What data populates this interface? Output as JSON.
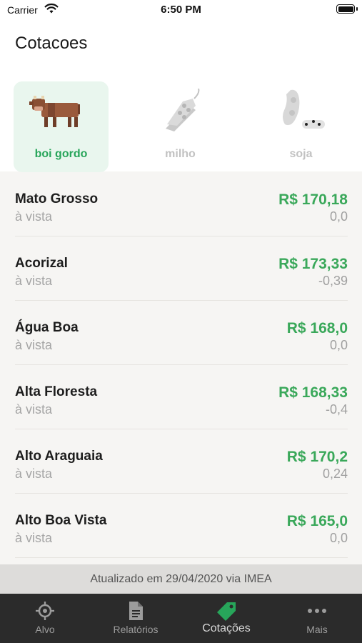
{
  "status_bar": {
    "carrier": "Carrier",
    "time": "6:50 PM"
  },
  "header": {
    "title": "Cotacoes"
  },
  "categories": [
    {
      "label": "boi gordo",
      "icon": "cow-icon",
      "active": true
    },
    {
      "label": "milho",
      "icon": "corn-icon",
      "active": false
    },
    {
      "label": "soja",
      "icon": "soy-icon",
      "active": false
    }
  ],
  "quotes": [
    {
      "name": "Mato Grosso",
      "sub": "à vista",
      "price": "R$ 170,18",
      "change": "0,0"
    },
    {
      "name": "Acorizal",
      "sub": "à vista",
      "price": "R$ 173,33",
      "change": "-0,39"
    },
    {
      "name": "Água Boa",
      "sub": "à vista",
      "price": "R$ 168,0",
      "change": "0,0"
    },
    {
      "name": "Alta Floresta",
      "sub": "à vista",
      "price": "R$ 168,33",
      "change": "-0,4"
    },
    {
      "name": "Alto Araguaia",
      "sub": "à vista",
      "price": "R$ 170,2",
      "change": "0,24"
    },
    {
      "name": "Alto Boa Vista",
      "sub": "à vista",
      "price": "R$ 165,0",
      "change": "0,0"
    }
  ],
  "footer": {
    "updated": "Atualizado em 29/04/2020 via IMEA"
  },
  "tabbar": {
    "items": [
      {
        "label": "Alvo",
        "icon": "target-icon"
      },
      {
        "label": "Relatórios",
        "icon": "document-icon"
      },
      {
        "label": "Cotações",
        "icon": "price-tag-icon"
      },
      {
        "label": "Mais",
        "icon": "more-dots-icon"
      }
    ]
  },
  "colors": {
    "accent_green": "#27a55a",
    "price_green": "#3aa85a",
    "tabbar_bg": "#2b2b2b"
  }
}
